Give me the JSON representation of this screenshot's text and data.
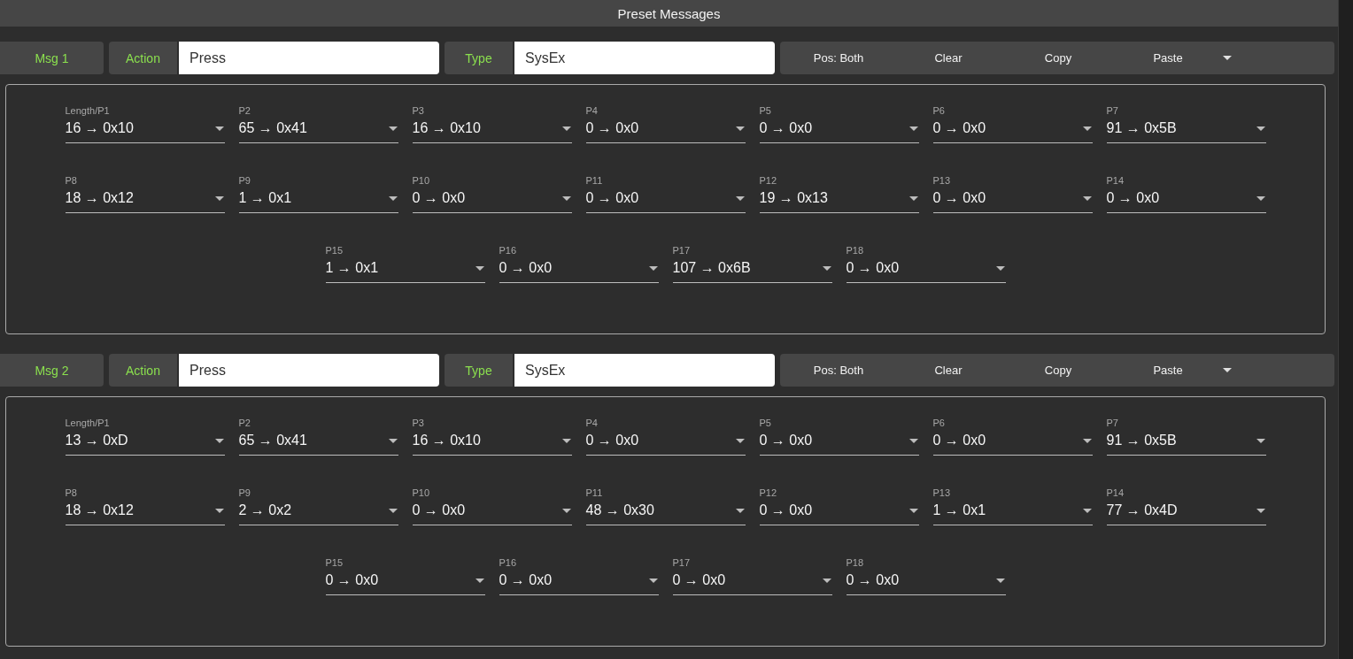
{
  "title": "Preset Messages",
  "messages": [
    {
      "label": "Msg 1",
      "action_label": "Action",
      "action": "Press",
      "type_label": "Type",
      "type": "SysEx",
      "buttons": [
        "Pos: Both",
        "Clear",
        "Copy",
        "Paste"
      ],
      "params": [
        {
          "label": "Length/P1",
          "value": "16 → 0x10"
        },
        {
          "label": "P2",
          "value": "65 → 0x41"
        },
        {
          "label": "P3",
          "value": "16 → 0x10"
        },
        {
          "label": "P4",
          "value": "0 → 0x0"
        },
        {
          "label": "P5",
          "value": "0 → 0x0"
        },
        {
          "label": "P6",
          "value": "0 → 0x0"
        },
        {
          "label": "P7",
          "value": "91 → 0x5B"
        },
        {
          "label": "P8",
          "value": "18 → 0x12"
        },
        {
          "label": "P9",
          "value": "1 → 0x1"
        },
        {
          "label": "P10",
          "value": "0 → 0x0"
        },
        {
          "label": "P11",
          "value": "0 → 0x0"
        },
        {
          "label": "P12",
          "value": "19 → 0x13"
        },
        {
          "label": "P13",
          "value": "0 → 0x0"
        },
        {
          "label": "P14",
          "value": "0 → 0x0"
        },
        {
          "label": "P15",
          "value": "1 → 0x1"
        },
        {
          "label": "P16",
          "value": "0 → 0x0"
        },
        {
          "label": "P17",
          "value": "107 → 0x6B"
        },
        {
          "label": "P18",
          "value": "0 → 0x0"
        }
      ]
    },
    {
      "label": "Msg 2",
      "action_label": "Action",
      "action": "Press",
      "type_label": "Type",
      "type": "SysEx",
      "buttons": [
        "Pos: Both",
        "Clear",
        "Copy",
        "Paste"
      ],
      "params": [
        {
          "label": "Length/P1",
          "value": "13 → 0xD"
        },
        {
          "label": "P2",
          "value": "65 → 0x41"
        },
        {
          "label": "P3",
          "value": "16 → 0x10"
        },
        {
          "label": "P4",
          "value": "0 → 0x0"
        },
        {
          "label": "P5",
          "value": "0 → 0x0"
        },
        {
          "label": "P6",
          "value": "0 → 0x0"
        },
        {
          "label": "P7",
          "value": "91 → 0x5B"
        },
        {
          "label": "P8",
          "value": "18 → 0x12"
        },
        {
          "label": "P9",
          "value": "2 → 0x2"
        },
        {
          "label": "P10",
          "value": "0 → 0x0"
        },
        {
          "label": "P11",
          "value": "48 → 0x30"
        },
        {
          "label": "P12",
          "value": "0 → 0x0"
        },
        {
          "label": "P13",
          "value": "1 → 0x1"
        },
        {
          "label": "P14",
          "value": "77 → 0x4D"
        },
        {
          "label": "P15",
          "value": "0 → 0x0"
        },
        {
          "label": "P16",
          "value": "0 → 0x0"
        },
        {
          "label": "P17",
          "value": "0 → 0x0"
        },
        {
          "label": "P18",
          "value": "0 → 0x0"
        }
      ]
    }
  ]
}
